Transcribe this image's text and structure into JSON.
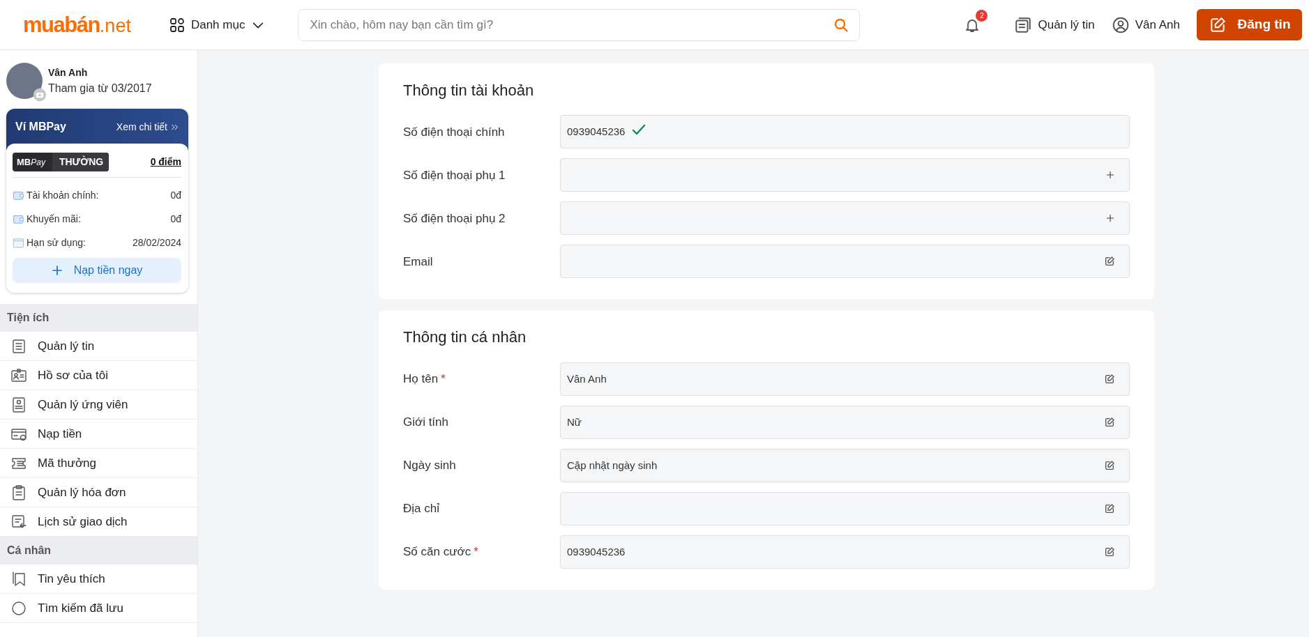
{
  "header": {
    "logo": {
      "main": "muabán",
      "suffix": ".net"
    },
    "category_menu": "Danh mục",
    "search": {
      "placeholder": "Xin chào, hôm nay bạn cần tìm gì?"
    },
    "notifications": {
      "count": "2"
    },
    "manage_link": "Quản lý tin",
    "user": "Vân Anh",
    "post_button": "Đăng tin"
  },
  "sidebar": {
    "profile": {
      "name": "Vân Anh",
      "joined": "Tham gia từ 03/2017"
    },
    "wallet": {
      "title": "Ví MBPay",
      "details_link": "Xem chi tiết",
      "tier": {
        "brand": "MB",
        "brand_suffix": "Pay",
        "level": "THƯỜNG"
      },
      "points": "0 điểm",
      "rows": [
        {
          "label": "Tài khoản chính:",
          "value": "0đ"
        },
        {
          "label": "Khuyến mãi:",
          "value": "0đ"
        },
        {
          "label": "Hạn sử dụng:",
          "value": "28/02/2024"
        }
      ],
      "topup_button": "Nạp tiền ngay"
    },
    "sections": [
      {
        "title": "Tiện ích",
        "items": [
          "Quản lý tin",
          "Hồ sơ của tôi",
          "Quản lý ứng viên",
          "Nạp tiền",
          "Mã thưởng",
          "Quản lý hóa đơn",
          "Lịch sử giao dịch"
        ]
      },
      {
        "title": "Cá nhân",
        "items": [
          "Tin yêu thích",
          "Tìm kiếm đã lưu"
        ]
      }
    ]
  },
  "cards": [
    {
      "title": "Thông tin tài khoản",
      "fields": [
        {
          "label": "Số điện thoại chính",
          "value": "0939045236",
          "kind": "check"
        },
        {
          "label": "Số điện thoại phụ 1",
          "kind": "plus"
        },
        {
          "label": "Số điện thoại phụ 2",
          "kind": "plus"
        },
        {
          "label": "Email",
          "kind": "edit"
        }
      ]
    },
    {
      "title": "Thông tin cá nhân",
      "fields": [
        {
          "label": "Họ tên",
          "mark": "*",
          "value": "Vân Anh",
          "kind": "edit"
        },
        {
          "label": "Giới tính",
          "value": "Nữ",
          "kind": "edit"
        },
        {
          "label": "Ngày sinh",
          "value": "Cập nhật ngày sinh",
          "kind": "edit"
        },
        {
          "label": "Địa chỉ",
          "kind": "edit"
        },
        {
          "label": "Số căn cước",
          "mark": "*",
          "value": "0939045236",
          "kind": "edit"
        }
      ]
    }
  ]
}
